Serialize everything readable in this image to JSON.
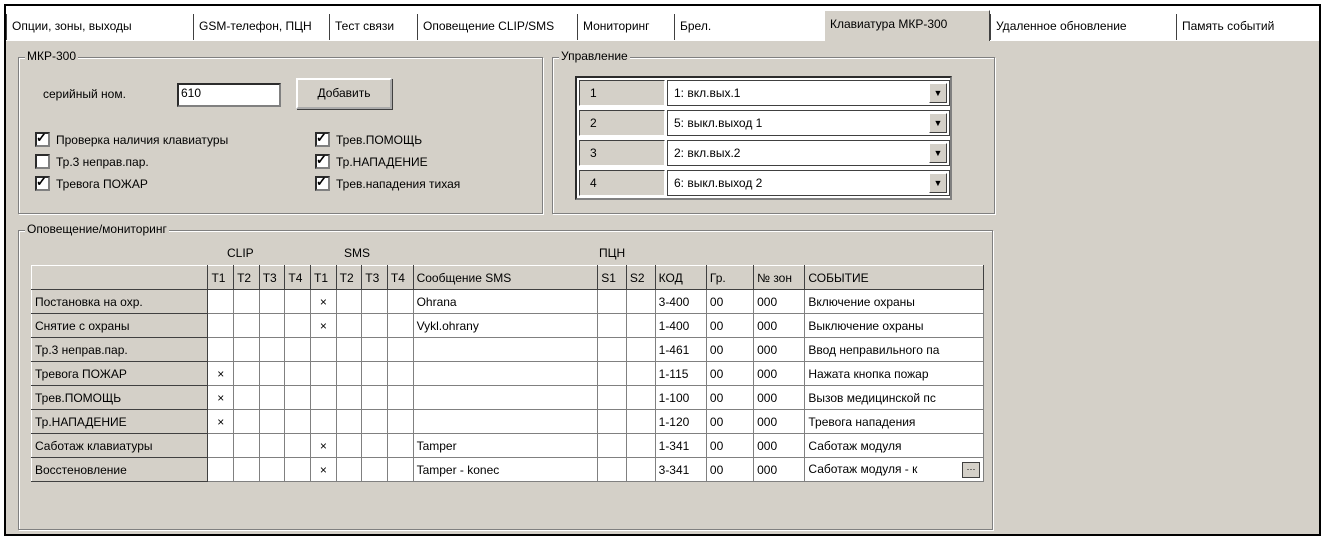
{
  "tabs": [
    "Опции, зоны, выходы",
    "GSM-телефон, ПЦН",
    "Тест связи",
    "Оповещение CLIP/SMS",
    "Мониторинг",
    "Брел.",
    "Клавиатура МКР-300",
    "Удаленное обновление",
    "Память событий"
  ],
  "active_tab": "Клавиатура МКР-300",
  "mkp": {
    "legend": "МКР-300",
    "serial_label": "серийный ном.",
    "serial_value": "610",
    "add_button": "Добавить",
    "checkboxes": [
      {
        "label": "Проверка наличия клавиатуры",
        "checked": true
      },
      {
        "label": "Тр.3 неправ.пар.",
        "checked": false
      },
      {
        "label": "Тревога ПОЖАР",
        "checked": true
      },
      {
        "label": "Трев.ПОМОЩЬ",
        "checked": true
      },
      {
        "label": "Тр.НАПАДЕНИЕ",
        "checked": true
      },
      {
        "label": "Трев.нападения тихая",
        "checked": true
      }
    ]
  },
  "control": {
    "legend": "Управление",
    "rows": [
      {
        "num": "1",
        "value": "1: вкл.вых.1"
      },
      {
        "num": "2",
        "value": "5: выкл.выход 1"
      },
      {
        "num": "3",
        "value": "2: вкл.вых.2"
      },
      {
        "num": "4",
        "value": "6: выкл.выход 2"
      }
    ]
  },
  "notify": {
    "legend": "Оповещение/мониторинг",
    "group_clip": "CLIP",
    "group_sms": "SMS",
    "group_pcn": "ПЦН",
    "columns": [
      "T1",
      "T2",
      "T3",
      "T4",
      "T1",
      "T2",
      "T3",
      "T4",
      "Сообщение SMS",
      "S1",
      "S2",
      "КОД",
      "Гр.",
      "№ зон",
      "СОБЫТИЕ"
    ],
    "rows": [
      {
        "name": "Постановка на охр.",
        "clip": [
          "",
          "",
          "",
          ""
        ],
        "sms": [
          "X",
          "",
          "",
          ""
        ],
        "msg": "Ohrana",
        "s1": "",
        "s2": "",
        "code": "3-400",
        "gr": "00",
        "zone": "000",
        "event": "Включение охраны"
      },
      {
        "name": "Снятие с охраны",
        "clip": [
          "",
          "",
          "",
          ""
        ],
        "sms": [
          "X",
          "",
          "",
          ""
        ],
        "msg": "Vykl.ohrany",
        "s1": "",
        "s2": "",
        "code": "1-400",
        "gr": "00",
        "zone": "000",
        "event": "Выключение охраны"
      },
      {
        "name": "Тр.3 неправ.пар.",
        "clip": [
          "",
          "",
          "",
          ""
        ],
        "sms": [
          "",
          "",
          "",
          ""
        ],
        "msg": "",
        "s1": "",
        "s2": "",
        "code": "1-461",
        "gr": "00",
        "zone": "000",
        "event": "Ввод неправильного па"
      },
      {
        "name": "Тревога ПОЖАР",
        "clip": [
          "X",
          "",
          "",
          ""
        ],
        "sms": [
          "",
          "",
          "",
          ""
        ],
        "msg": "",
        "s1": "",
        "s2": "",
        "code": "1-115",
        "gr": "00",
        "zone": "000",
        "event": "Нажата кнопка пожар"
      },
      {
        "name": "Трев.ПОМОЩЬ",
        "clip": [
          "X",
          "",
          "",
          ""
        ],
        "sms": [
          "",
          "",
          "",
          ""
        ],
        "msg": "",
        "s1": "",
        "s2": "",
        "code": "1-100",
        "gr": "00",
        "zone": "000",
        "event": "Вызов медицинской пс"
      },
      {
        "name": "Тр.НАПАДЕНИЕ",
        "clip": [
          "X",
          "",
          "",
          ""
        ],
        "sms": [
          "",
          "",
          "",
          ""
        ],
        "msg": "",
        "s1": "",
        "s2": "",
        "code": "1-120",
        "gr": "00",
        "zone": "000",
        "event": "Тревога нападения"
      },
      {
        "name": "Саботаж клавиатуры",
        "clip": [
          "",
          "",
          "",
          ""
        ],
        "sms": [
          "X",
          "",
          "",
          ""
        ],
        "msg": "Tamper",
        "s1": "",
        "s2": "",
        "code": "1-341",
        "gr": "00",
        "zone": "000",
        "event": "Саботаж модуля"
      },
      {
        "name": "Восстеновление",
        "clip": [
          "",
          "",
          "",
          ""
        ],
        "sms": [
          "X",
          "",
          "",
          ""
        ],
        "msg": "Tamper - konec",
        "s1": "",
        "s2": "",
        "code": "3-341",
        "gr": "00",
        "zone": "000",
        "event": "Саботаж модуля - к"
      }
    ]
  }
}
